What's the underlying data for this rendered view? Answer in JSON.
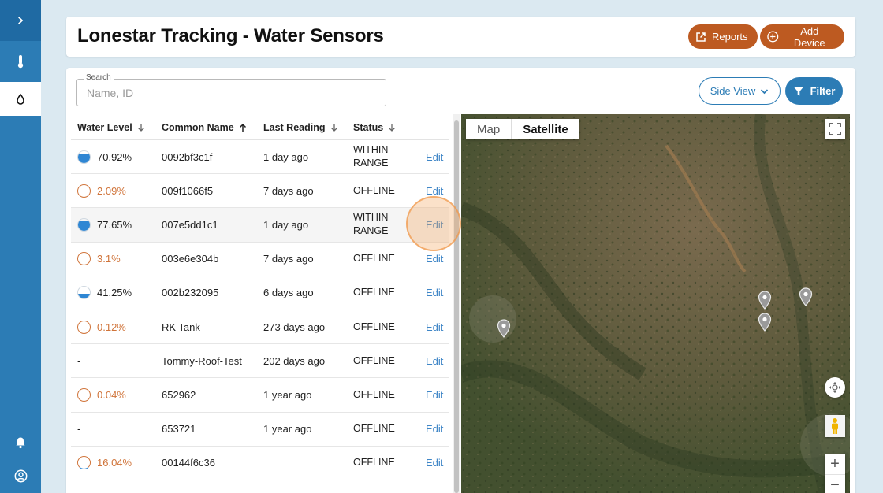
{
  "sidebar": {
    "expand_icon": "chevron-right-icon",
    "items": [
      {
        "name": "temperature",
        "icon": "thermometer-icon"
      },
      {
        "name": "water",
        "icon": "droplet-icon"
      }
    ],
    "bottom": [
      {
        "name": "notifications",
        "icon": "bell-icon"
      },
      {
        "name": "account",
        "icon": "user-circle-icon"
      }
    ]
  },
  "header": {
    "title": "Lonestar Tracking - Water Sensors",
    "reports_label": "Reports",
    "add_device_label": "Add Device",
    "accent": "#bd5a21"
  },
  "search": {
    "label": "Search",
    "placeholder": "Name, ID",
    "value": ""
  },
  "toolbar": {
    "side_view_label": "Side View",
    "filter_label": "Filter"
  },
  "table": {
    "columns": [
      "Water Level",
      "Common Name",
      "Last Reading",
      "Status"
    ],
    "sort_icons": [
      "arrow-down-icon",
      "arrow-up-icon",
      "arrow-down-icon",
      "arrow-down-icon"
    ],
    "edit_label": "Edit",
    "rows": [
      {
        "level": "70.92%",
        "level_fraction": 0.7092,
        "kind": "tank",
        "name": "0092bf3c1f",
        "reading": "1 day ago",
        "status": "WITHIN RANGE"
      },
      {
        "level": "2.09%",
        "level_fraction": 0.0209,
        "kind": "low",
        "name": "009f1066f5",
        "reading": "7 days ago",
        "status": "OFFLINE"
      },
      {
        "level": "77.65%",
        "level_fraction": 0.7765,
        "kind": "tank",
        "name": "007e5dd1c1",
        "reading": "1 day ago",
        "status": "WITHIN RANGE"
      },
      {
        "level": "3.1%",
        "level_fraction": 0.031,
        "kind": "low",
        "name": "003e6e304b",
        "reading": "7 days ago",
        "status": "OFFLINE"
      },
      {
        "level": "41.25%",
        "level_fraction": 0.4125,
        "kind": "tank",
        "name": "002b232095",
        "reading": "6 days ago",
        "status": "OFFLINE"
      },
      {
        "level": "0.12%",
        "level_fraction": 0.0012,
        "kind": "low",
        "name": "RK Tank",
        "reading": "273 days ago",
        "status": "OFFLINE"
      },
      {
        "level": "-",
        "level_fraction": null,
        "kind": "none",
        "name": "Tommy-Roof-Test",
        "reading": "202 days ago",
        "status": "OFFLINE"
      },
      {
        "level": "0.04%",
        "level_fraction": 0.0004,
        "kind": "low",
        "name": "652962",
        "reading": "1 year ago",
        "status": "OFFLINE"
      },
      {
        "level": "-",
        "level_fraction": null,
        "kind": "none",
        "name": "653721",
        "reading": "1 year ago",
        "status": "OFFLINE"
      },
      {
        "level": "16.04%",
        "level_fraction": 0.1604,
        "kind": "low",
        "name": "00144f6c36",
        "reading": "",
        "status": "OFFLINE"
      }
    ]
  },
  "map": {
    "tabs": [
      "Map",
      "Satellite"
    ],
    "active_tab": "Satellite",
    "controls": {
      "fullscreen": "fullscreen-icon",
      "camera": "camera-control-icon",
      "pegman": "pegman-icon",
      "zoom_in": "+",
      "zoom_out": "−"
    },
    "marker_count": 4
  }
}
